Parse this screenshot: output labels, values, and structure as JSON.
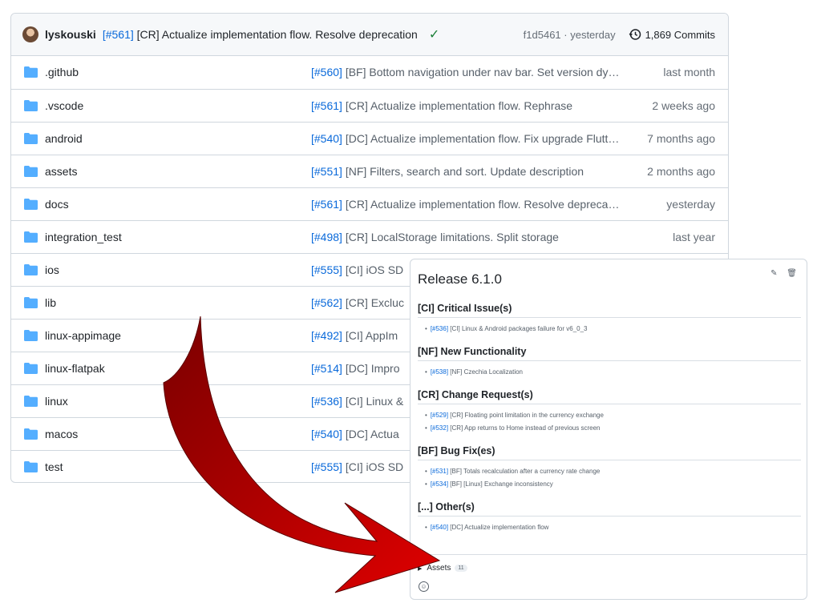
{
  "commit_bar": {
    "author": "lyskouski",
    "ref": "[#561]",
    "message": "[CR] Actualize implementation flow. Resolve deprecation",
    "check": "✓",
    "sha_time": "f1d5461 · yesterday",
    "commits": "1,869 Commits"
  },
  "files": [
    {
      "name": ".github",
      "ref": "[#560]",
      "msg": " [BF] Bottom navigation under nav bar. Set version dy…",
      "date": "last month"
    },
    {
      "name": ".vscode",
      "ref": "[#561]",
      "msg": " [CR] Actualize implementation flow. Rephrase",
      "date": "2 weeks ago"
    },
    {
      "name": "android",
      "ref": "[#540]",
      "msg": " [DC] Actualize implementation flow. Fix upgrade Flutt…",
      "date": "7 months ago"
    },
    {
      "name": "assets",
      "ref": "[#551]",
      "msg": " [NF] Filters, search and sort. Update description",
      "date": "2 months ago"
    },
    {
      "name": "docs",
      "ref": "[#561]",
      "msg": " [CR] Actualize implementation flow. Resolve deprecat…",
      "date": "yesterday"
    },
    {
      "name": "integration_test",
      "ref": "[#498]",
      "msg": " [CR] LocalStorage limitations. Split storage",
      "date": "last year"
    },
    {
      "name": "ios",
      "ref": "[#555]",
      "msg": " [CI] iOS SD",
      "date": ""
    },
    {
      "name": "lib",
      "ref": "[#562]",
      "msg": " [CR] Excluc",
      "date": ""
    },
    {
      "name": "linux-appimage",
      "ref": "[#492]",
      "msg": " [CI] AppIm",
      "date": ""
    },
    {
      "name": "linux-flatpak",
      "ref": "[#514]",
      "msg": " [DC] Impro",
      "date": ""
    },
    {
      "name": "linux",
      "ref": "[#536]",
      "msg": " [CI] Linux &",
      "date": ""
    },
    {
      "name": "macos",
      "ref": "[#540]",
      "msg": " [DC] Actua",
      "date": ""
    },
    {
      "name": "test",
      "ref": "[#555]",
      "msg": " [CI] iOS SD",
      "date": ""
    }
  ],
  "release": {
    "title": "Release 6.1.0",
    "edit_icon": "pencil-icon",
    "delete_icon": "trash-icon",
    "sections": [
      {
        "heading": "[CI] Critical Issue(s)",
        "items": [
          {
            "ref": "[#536]",
            "text": " [CI] Linux & Android packages failure for v6_0_3"
          }
        ]
      },
      {
        "heading": "[NF] New Functionality",
        "items": [
          {
            "ref": "[#538]",
            "text": " [NF] Czechia Localization"
          }
        ]
      },
      {
        "heading": "[CR] Change Request(s)",
        "items": [
          {
            "ref": "[#529]",
            "text": " [CR] Floating point limitation in the currency exchange"
          },
          {
            "ref": "[#532]",
            "text": " [CR] App returns to Home instead of previous screen"
          }
        ]
      },
      {
        "heading": "[BF] Bug Fix(es)",
        "items": [
          {
            "ref": "[#531]",
            "text": " [BF] Totals recalculation after a currency rate change"
          },
          {
            "ref": "[#534]",
            "text": " [BF] [Linux] Exchange inconsistency"
          }
        ]
      },
      {
        "heading": "[...] Other(s)",
        "items": [
          {
            "ref": "[#540]",
            "text": " [DC] Actualize implementation flow"
          }
        ]
      }
    ],
    "assets_label": "Assets",
    "assets_count": "11"
  },
  "colors": {
    "accent_link": "#0969da",
    "folder": "#54aeff",
    "arrow": "#d40000",
    "check": "#1a7f37"
  }
}
